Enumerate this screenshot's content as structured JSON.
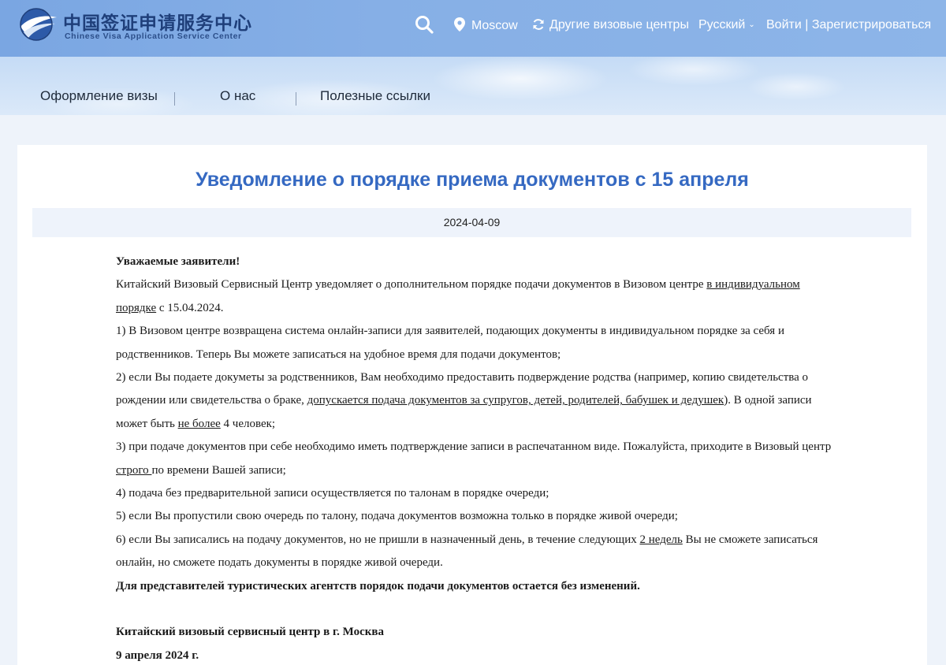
{
  "header": {
    "logo": {
      "cn": "中国签证申请服务中心",
      "en": "Chinese Visa Application Service Center"
    },
    "search_icon": "search-icon",
    "location": "Moscow",
    "other_centers": "Другие визовые центры",
    "language": "Русский",
    "login": "Войти",
    "separator": "|",
    "register": "Зарегистрироваться",
    "colors": {
      "topbar": "#86afe6",
      "text": "#ffffff"
    }
  },
  "nav": {
    "items": [
      {
        "label": "Оформление визы"
      },
      {
        "label": "О нас"
      },
      {
        "label": "Полезные ссылки"
      }
    ]
  },
  "article": {
    "title": "Уведомление о порядке приема документов с 15 апреля",
    "date": "2024-04-09",
    "greeting": "Уважаемые заявители!",
    "intro_a": "Китайский Визовый Сервисный Центр уведомляет о дополнительном порядке подачи документов в Визовом центре ",
    "intro_u": "в индивидуальном порядке",
    "intro_b": " с 15.04.2024.",
    "p1": "1) В Визовом центре возвращена система онлайн-записи для заявителей, подающих документы в индивидуальном порядке за себя и родственников. Теперь Вы можете записаться на удобное время для подачи документов;",
    "p2_a": "2) если Вы подаете докуметы за родственников, Вам необходимо предоставить подверждение родства (например, копию свидетельства о рождении или свидетельства о браке, ",
    "p2_u": "допускается подача документов за супругов, детей, родителей, бабушек и дедушек",
    "p2_b": "). В одной записи может быть ",
    "p2_u2": "не более",
    "p2_c": " 4 человек;",
    "p3_a": "3) при подаче документов при себе необходимо иметь подтверждение записи в распечатанном виде. Пожалуйста, приходите в Визовый центр ",
    "p3_u": "строго ",
    "p3_b": "по времени Вашей записи;",
    "p4": "4) подача без предварительной записи осуществляется по талонам в порядке очереди;",
    "p5": "5) если Вы пропустили свою очередь по талону, подача документов возможна только в порядке живой очереди;",
    "p6_a": "6) если Вы записались на подачу документов, но не пришли в назначенный день, в течение следующих ",
    "p6_u": "2 недель",
    "p6_b": " Вы не сможете записаться онлайн, но сможете подать документы в порядке живой очереди.",
    "agencies": "Для представителей туристических агентств порядок подачи документов остается без изменений.",
    "signature": "Китайский визовый сервисный центр в г. Москва",
    "sign_date": "9 апреля 2024 г.",
    "colors": {
      "title": "#3569c2",
      "date_bar": "#eef3fb"
    }
  }
}
